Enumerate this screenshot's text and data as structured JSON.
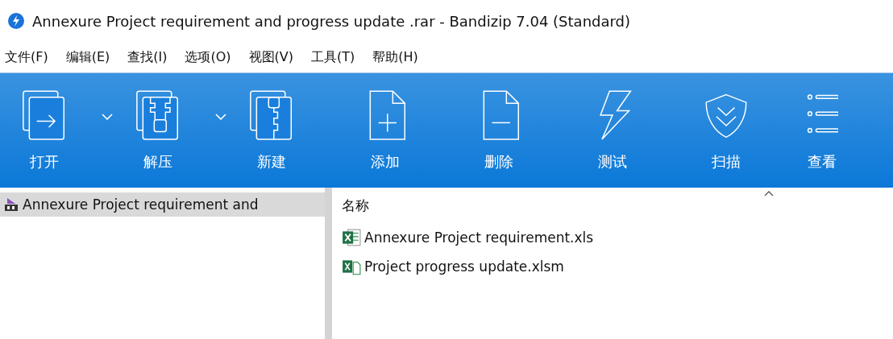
{
  "window": {
    "title": "Annexure Project requirement and progress update .rar - Bandizip 7.04 (Standard)"
  },
  "menu": [
    "文件(F)",
    "编辑(E)",
    "查找(I)",
    "选项(O)",
    "视图(V)",
    "工具(T)",
    "帮助(H)"
  ],
  "toolbar": [
    {
      "kind": "open",
      "label": "打开",
      "dropdown": true
    },
    {
      "kind": "extract",
      "label": "解压",
      "dropdown": true
    },
    {
      "kind": "new",
      "label": "新建",
      "dropdown": false
    },
    {
      "kind": "add",
      "label": "添加",
      "dropdown": false
    },
    {
      "kind": "delete",
      "label": "删除",
      "dropdown": false
    },
    {
      "kind": "test",
      "label": "测试",
      "dropdown": false
    },
    {
      "kind": "scan",
      "label": "扫描",
      "dropdown": false
    },
    {
      "kind": "view",
      "label": "查看",
      "dropdown": false
    }
  ],
  "tree": {
    "items": [
      {
        "label": "Annexure Project requirement and",
        "selected": true
      }
    ]
  },
  "list": {
    "columns": [
      {
        "label": "名称"
      }
    ],
    "rows": [
      {
        "name": "Annexure Project requirement.xls",
        "kind": "xls"
      },
      {
        "name": "Project progress update.xlsm",
        "kind": "xlsm"
      }
    ]
  }
}
